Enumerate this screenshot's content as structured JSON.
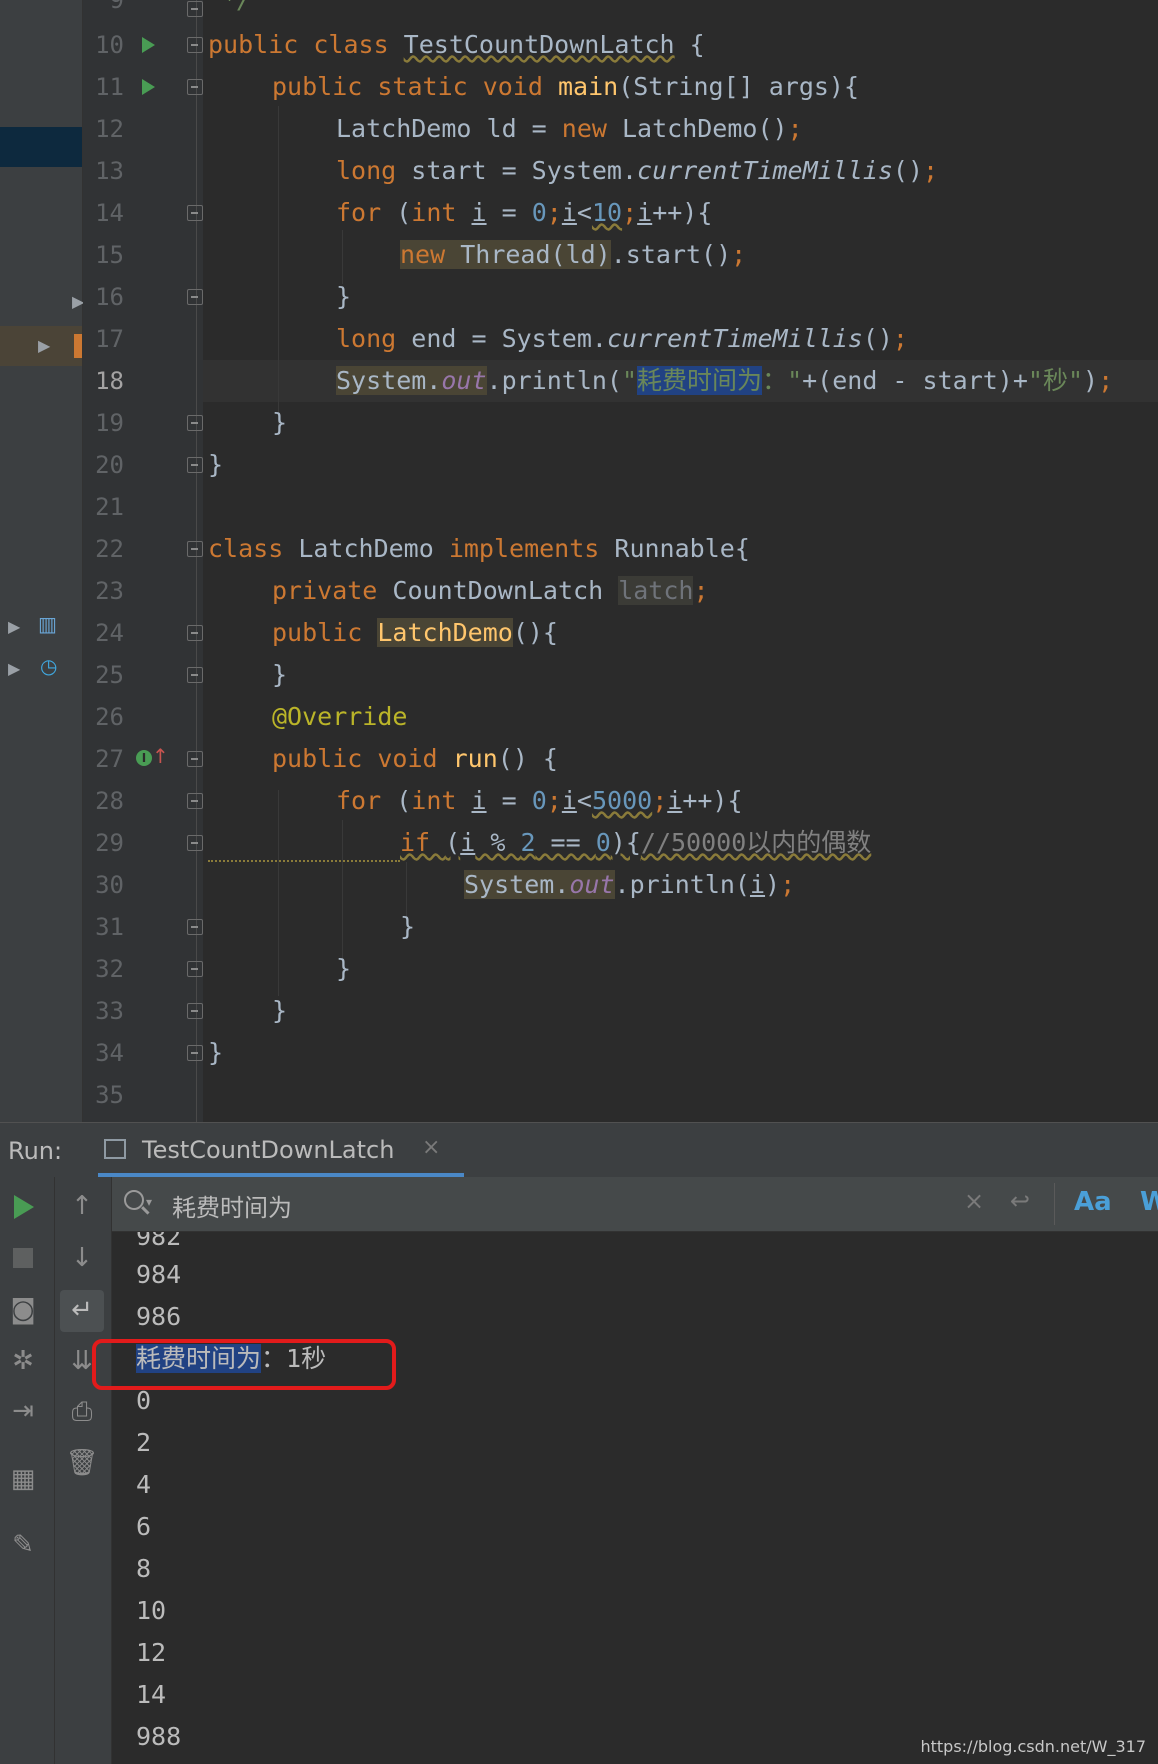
{
  "editor": {
    "line_numbers": [
      "9",
      "10",
      "11",
      "12",
      "13",
      "14",
      "15",
      "16",
      "17",
      "18",
      "19",
      "20",
      "21",
      "22",
      "23",
      "24",
      "25",
      "26",
      "27",
      "28",
      "29",
      "30",
      "31",
      "32",
      "33",
      "34",
      "35"
    ],
    "comment_tail": "*/",
    "code": {
      "l10_kw": "public class ",
      "l10_cls": "TestCountDownLatch",
      "l10_rest": " {",
      "l11_kw": "public static void ",
      "l11_fn": "main",
      "l11_rest": "(String[] args){",
      "l12_a": "LatchDemo ld = ",
      "l12_kw": "new ",
      "l12_b": "LatchDemo()",
      "l12_semi": ";",
      "l13_kw": "long ",
      "l13_a": "start = System.",
      "l13_i": "currentTimeMillis",
      "l13_b": "()",
      "l13_semi": ";",
      "l14_kw": "for ",
      "l14_a": "(",
      "l14_kw2": "int ",
      "l14_i": "i",
      "l14_b": " = ",
      "l14_n0": "0",
      "l14_s1": ";",
      "l14_i2": "i",
      "l14_lt": "<",
      "l14_n10": "10",
      "l14_s2": ";",
      "l14_i3": "i",
      "l14_c": "++){",
      "l15_kw": "new ",
      "l15_a": "Thread(ld)",
      "l15_b": ".start()",
      "l15_semi": ";",
      "l16": "}",
      "l17_kw": "long ",
      "l17_a": "end = System.",
      "l17_i": "currentTimeMillis",
      "l17_b": "()",
      "l17_semi": ";",
      "l18_a": "System.",
      "l18_out": "out",
      "l18_b": ".println(",
      "l18_q": "\"",
      "l18_sel": "耗费时间为",
      "l18_s": "：\"",
      "l18_c": "+(end - start)+",
      "l18_s2": "\"秒\"",
      "l18_d": ")",
      "l18_semi": ";",
      "l19": "}",
      "l20": "}",
      "l22_kw": "class ",
      "l22_a": "LatchDemo ",
      "l22_kw2": "implements ",
      "l22_b": "Runnable{",
      "l23_kw": "private ",
      "l23_a": "CountDownLatch ",
      "l23_f": "latch",
      "l23_semi": ";",
      "l24_kw": "public ",
      "l24_fn": "LatchDemo",
      "l24_b": "(){",
      "l25": "}",
      "l26_ann": "@Override",
      "l27_kw": "public void ",
      "l27_fn": "run",
      "l27_b": "() {",
      "l28_kw": "for ",
      "l28_a": "(",
      "l28_kw2": "int ",
      "l28_i": "i",
      "l28_b": " = ",
      "l28_n0": "0",
      "l28_s1": ";",
      "l28_i2": "i",
      "l28_lt": "<",
      "l28_n": "5000",
      "l28_s2": ";",
      "l28_i3": "i",
      "l28_c": "++){",
      "l29_kw": "if ",
      "l29_a": "(",
      "l29_i": "i",
      "l29_b": " % ",
      "l29_n2": "2",
      "l29_c": " == ",
      "l29_n0": "0",
      "l29_d": "){",
      "l29_cmt": "//50000以内的偶数",
      "l30_a": "System.",
      "l30_out": "out",
      "l30_b": ".println(",
      "l30_i": "i",
      "l30_c": ")",
      "l30_semi": ";",
      "l31": "}",
      "l32": "}",
      "l33": "}",
      "l34": "}"
    }
  },
  "run_panel": {
    "title": "Run:",
    "tab_label": "TestCountDownLatch",
    "tab_close": "×",
    "search": {
      "value": "耗费时间为",
      "clear": "×",
      "match_case": "Aa",
      "words": "W"
    },
    "output": {
      "partial_top": "982",
      "lines_before": [
        "984",
        "986"
      ],
      "highlighted_line": {
        "selected": "耗费时间为",
        "rest": "：1秒"
      },
      "lines_after": [
        "0",
        "2",
        "4",
        "6",
        "8",
        "10",
        "12",
        "14",
        "988"
      ]
    }
  },
  "watermark": "https://blog.csdn.net/W_317"
}
